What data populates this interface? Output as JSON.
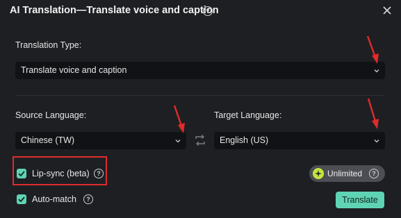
{
  "dialog": {
    "title": "AI Translation—Translate voice and caption",
    "help_glyph": "?"
  },
  "translation_type": {
    "label": "Translation Type:",
    "value": "Translate voice and caption"
  },
  "source_language": {
    "label": "Source Language:",
    "value": "Chinese (TW)"
  },
  "target_language": {
    "label": "Target Language:",
    "value": "English (US)"
  },
  "options": {
    "lip_sync_label": "Lip-sync (beta)",
    "lip_sync_checked": true,
    "auto_match_label": "Auto-match",
    "auto_match_checked": true
  },
  "credits": {
    "label": "Unlimited"
  },
  "actions": {
    "translate_label": "Translate"
  },
  "colors": {
    "accent": "#5fd4b4",
    "annotation_red": "#e02b2b",
    "background": "#1e1f23",
    "field_bg": "#111215"
  },
  "icons": [
    "help-icon",
    "close-icon",
    "chevron-down-icon",
    "swap-icon",
    "check-icon",
    "star-icon"
  ]
}
